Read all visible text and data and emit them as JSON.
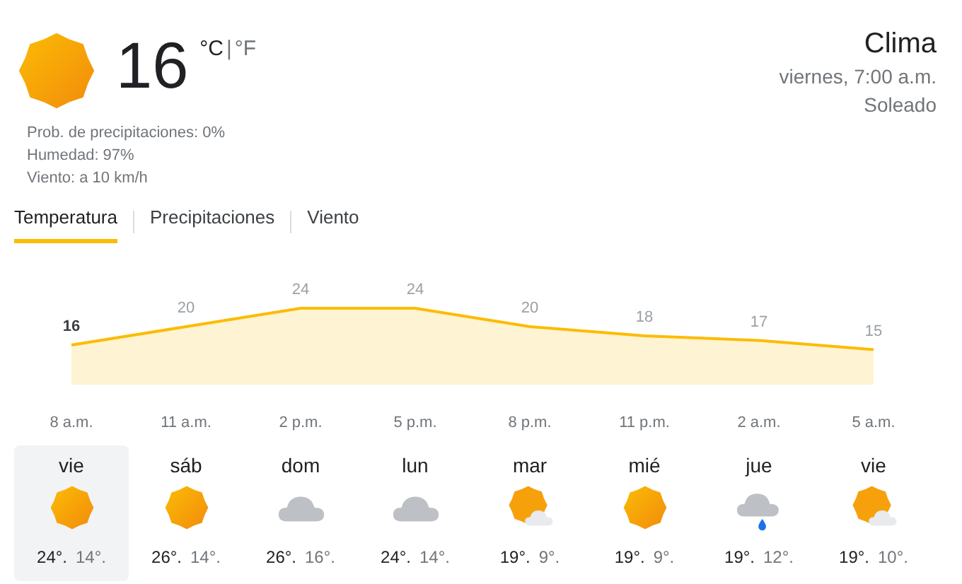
{
  "current": {
    "temperature": "16",
    "unit_c": "°C",
    "separator": "|",
    "unit_f": "°F",
    "details": [
      "Prob. de precipitaciones: 0%",
      "Humedad: 97%",
      "Viento: a 10 km/h"
    ]
  },
  "header": {
    "title": "Clima",
    "datetime": "viernes, 7:00 a.m.",
    "condition": "Soleado"
  },
  "tabs": [
    {
      "label": "Temperatura",
      "selected": true
    },
    {
      "label": "Precipitaciones",
      "selected": false
    },
    {
      "label": "Viento",
      "selected": false
    }
  ],
  "chart": {
    "chart_data": {
      "type": "area",
      "categories": [
        "8 a.m.",
        "11 a.m.",
        "2 p.m.",
        "5 p.m.",
        "8 p.m.",
        "11 p.m.",
        "2 a.m.",
        "5 a.m."
      ],
      "series": [
        {
          "color": "#fbbc04",
          "values": [
            16,
            20,
            24,
            24,
            20,
            18,
            17,
            15
          ]
        }
      ],
      "data_labels": true
    }
  },
  "days": [
    {
      "day": "vie",
      "kind": "sun",
      "high": "24°.",
      "low": "14°.",
      "selected": true
    },
    {
      "day": "sáb",
      "kind": "sun",
      "high": "26°.",
      "low": "14°.",
      "selected": false
    },
    {
      "day": "dom",
      "kind": "cloud",
      "high": "26°.",
      "low": "16°.",
      "selected": false
    },
    {
      "day": "lun",
      "kind": "cloud",
      "high": "24°.",
      "low": "14°.",
      "selected": false
    },
    {
      "day": "mar",
      "kind": "partly",
      "high": "19°.",
      "low": "9°.",
      "selected": false
    },
    {
      "day": "mié",
      "kind": "sun",
      "high": "19°.",
      "low": "9°.",
      "selected": false
    },
    {
      "day": "jue",
      "kind": "rain",
      "high": "19°.",
      "low": "12°.",
      "selected": false
    },
    {
      "day": "vie",
      "kind": "partly",
      "high": "19°.",
      "low": "10°.",
      "selected": false
    }
  ]
}
